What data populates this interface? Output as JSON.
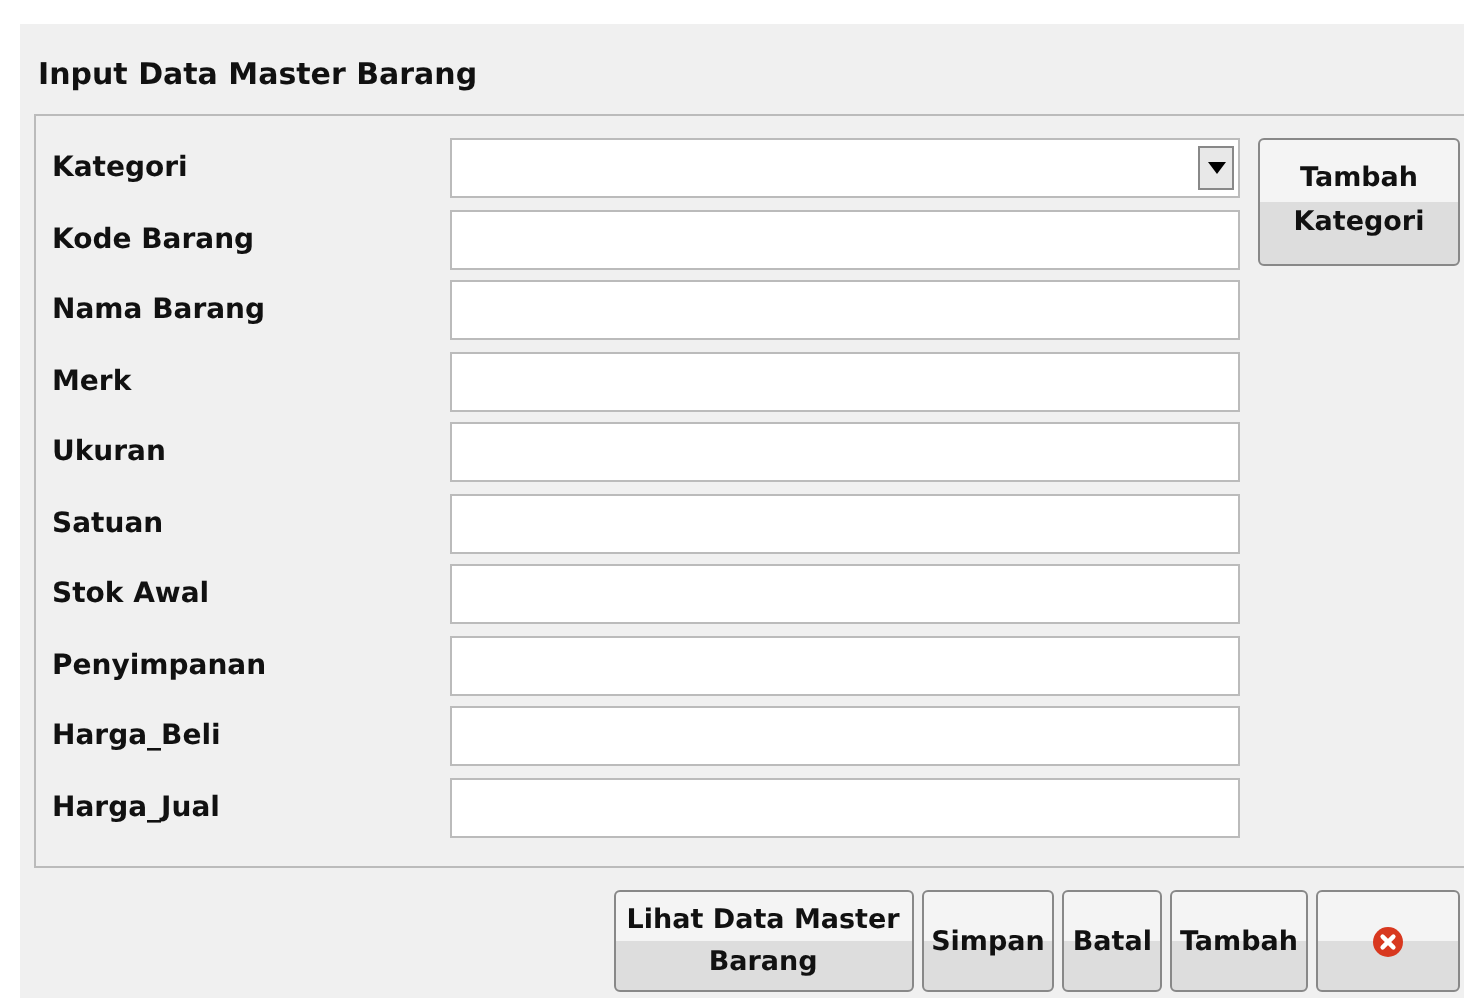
{
  "title": "Input Data Master Barang",
  "fields": [
    {
      "label": "Kategori",
      "kind": "dropdown"
    },
    {
      "label": "Kode Barang",
      "kind": "text"
    },
    {
      "label": "Nama Barang",
      "kind": "text"
    },
    {
      "label": "Merk",
      "kind": "text"
    },
    {
      "label": "Ukuran",
      "kind": "text"
    },
    {
      "label": "Satuan",
      "kind": "text"
    },
    {
      "label": "Stok Awal",
      "kind": "text"
    },
    {
      "label": "Penyimpanan",
      "kind": "text"
    },
    {
      "label": "Harga_Beli",
      "kind": "text"
    },
    {
      "label": "Harga_Jual",
      "kind": "text"
    }
  ],
  "side_button": "Tambah Kategori",
  "buttons": [
    {
      "label": "Lihat Data Master Barang",
      "kind": "text"
    },
    {
      "label": "Simpan",
      "kind": "text"
    },
    {
      "label": "Batal",
      "kind": "text"
    },
    {
      "label": "Tambah",
      "kind": "text"
    },
    {
      "kind": "close-icon"
    }
  ]
}
